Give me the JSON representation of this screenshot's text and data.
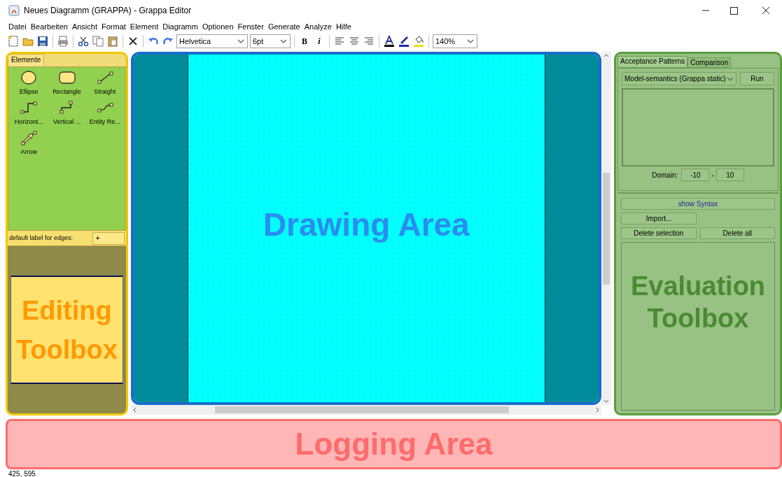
{
  "window": {
    "title": "Neues Diagramm (GRAPPA) - Grappa Editor"
  },
  "menu": [
    "Datei",
    "Bearbeiten",
    "Ansicht",
    "Format",
    "Element",
    "Diagramm",
    "Optionen",
    "Fenster",
    "Generate",
    "Analyze",
    "Hilfe"
  ],
  "toolbar": {
    "font": "Helvetica",
    "size": "6pt",
    "bold": "B",
    "italic": "i",
    "zoom": "140%"
  },
  "editing_toolbox": {
    "tabs": [
      {
        "label": "Elemente",
        "selected": true
      }
    ],
    "elements": [
      {
        "kind": "ellipse",
        "label": "Ellipse"
      },
      {
        "kind": "rectangle",
        "label": "Rectangle"
      },
      {
        "kind": "straight",
        "label": "Straight"
      },
      {
        "kind": "horizontal",
        "label": "Horizont..."
      },
      {
        "kind": "vertical",
        "label": "Vertical ..."
      },
      {
        "kind": "entity",
        "label": "Entity Re..."
      },
      {
        "kind": "arrow",
        "label": "Arrow"
      }
    ],
    "edge_label": {
      "label": "default label for edges:",
      "value": "+"
    },
    "callout": "Editing Toolbox"
  },
  "drawing_area": {
    "callout": "Drawing Area"
  },
  "evaluation_toolbox": {
    "tabs": [
      {
        "label": "Acceptance Patterns",
        "selected": true
      },
      {
        "label": "Comparison",
        "selected": false
      }
    ],
    "semantics": "Model-semantics (Grappa static)",
    "run": "Run",
    "domain": {
      "label": "Domain:",
      "from": "-10",
      "separator": "-",
      "to": "10"
    },
    "show_syntax": "show Syntax",
    "import": "Import...",
    "delete_selection": "Delete selection",
    "delete_all": "Delete all",
    "callout": "Evaluation Toolbox"
  },
  "logging_area": {
    "callout": "Logging Area"
  },
  "status_bar": "425, 595"
}
